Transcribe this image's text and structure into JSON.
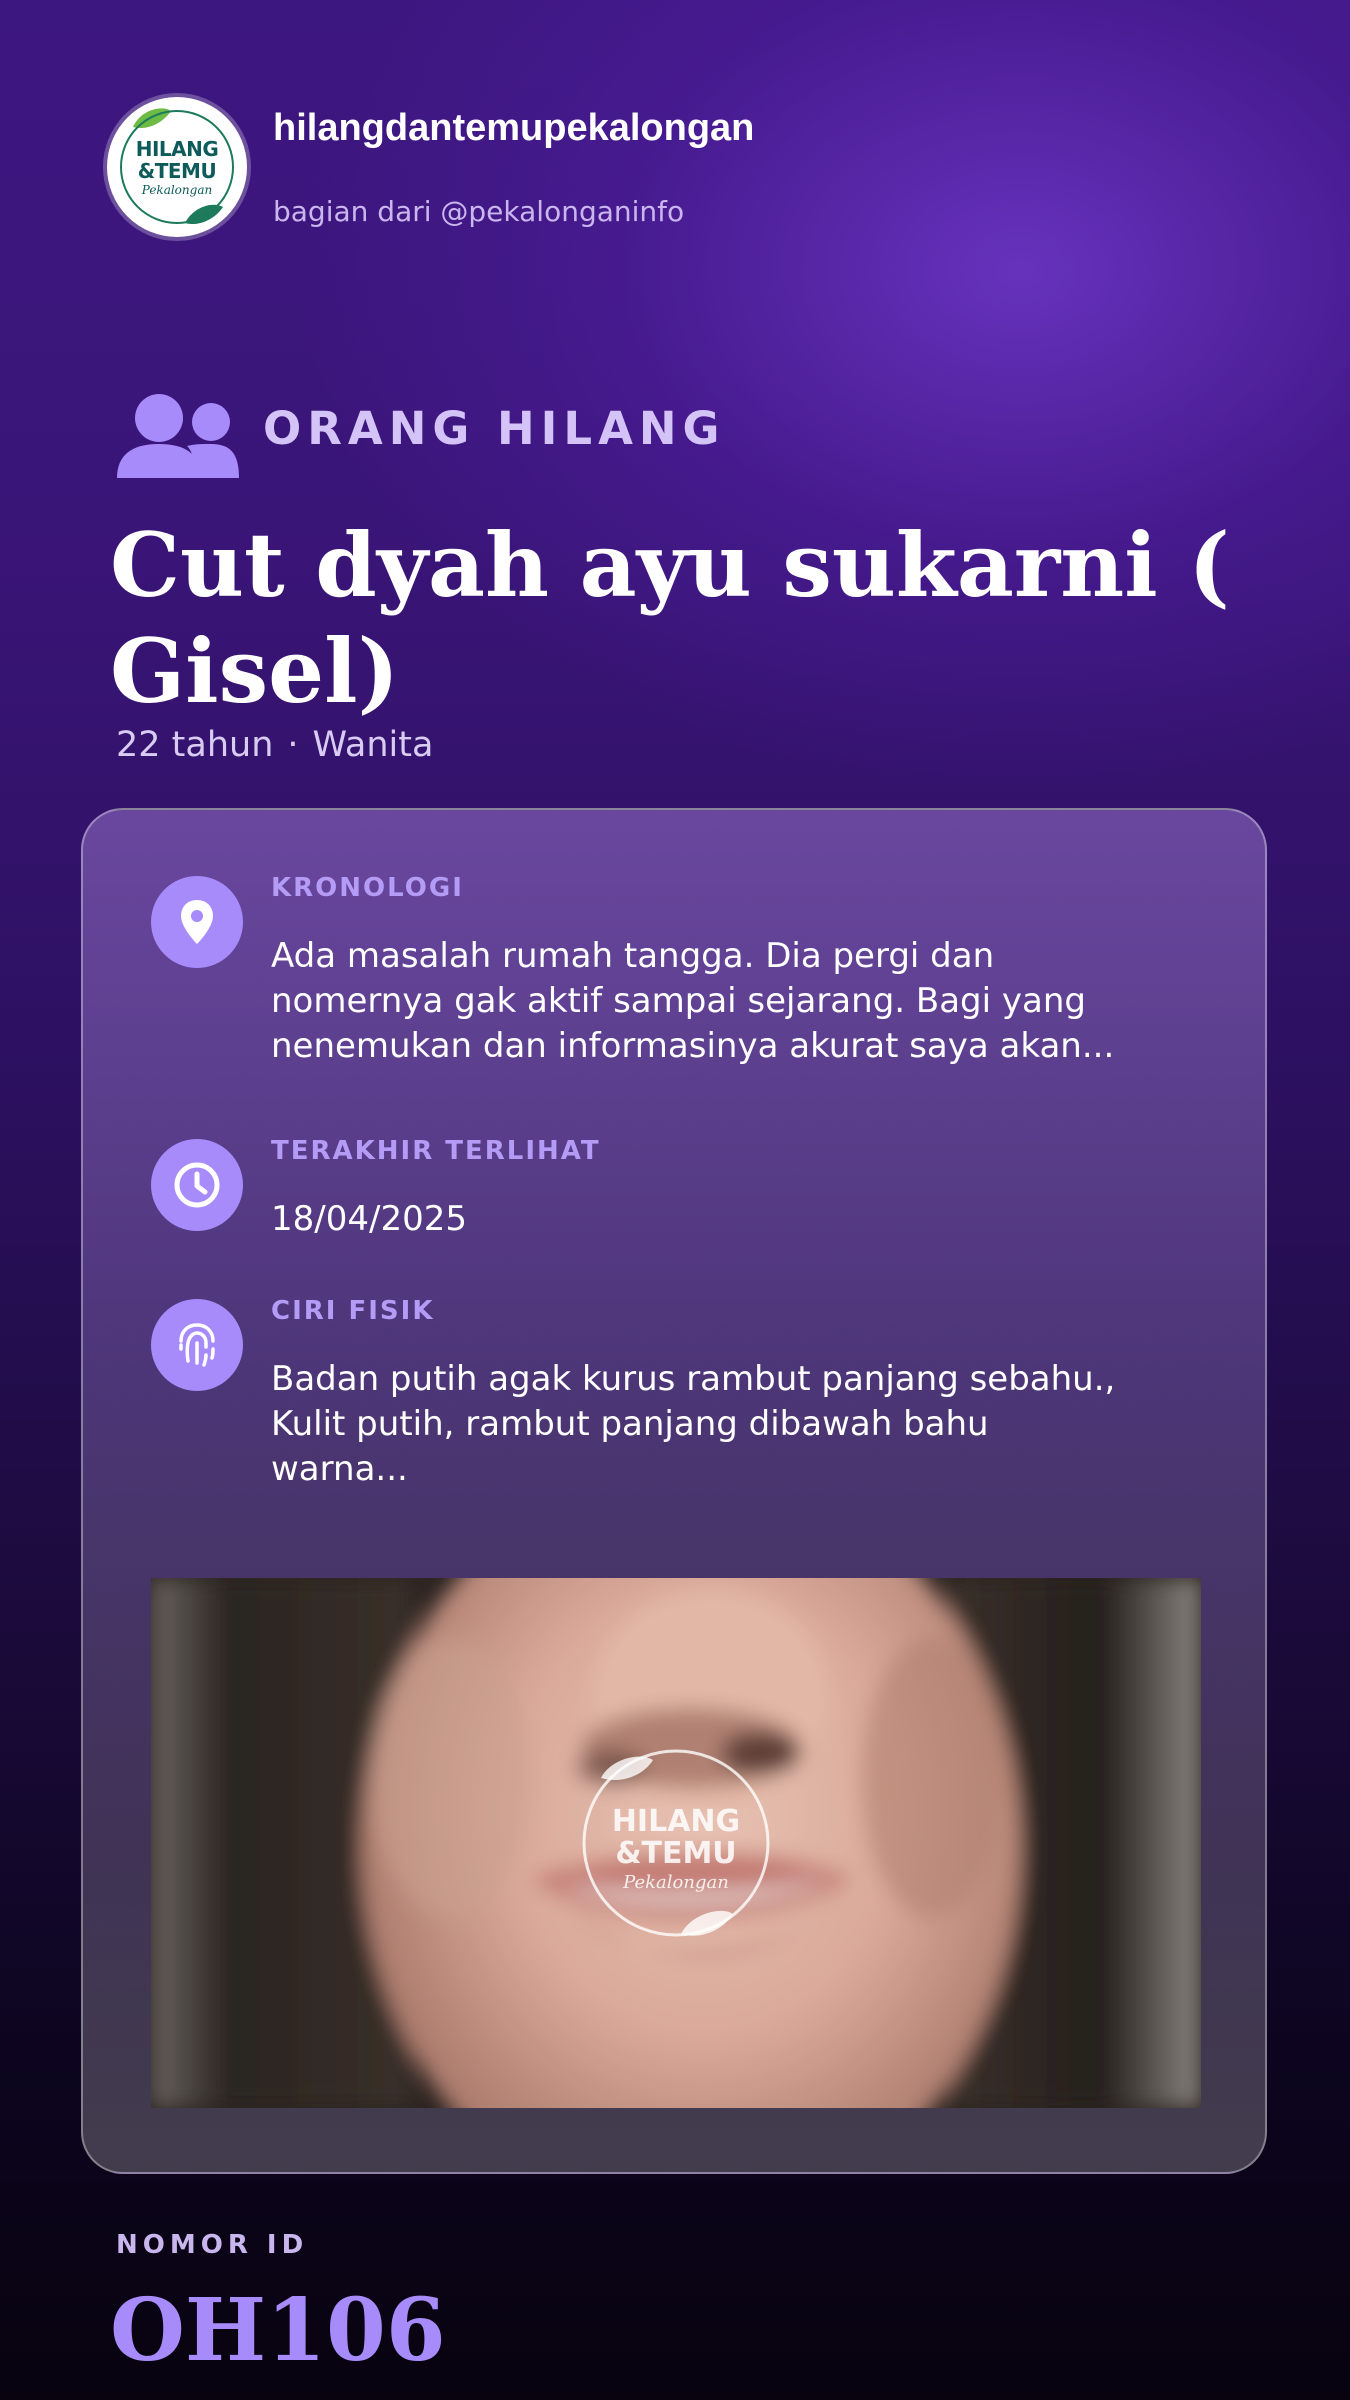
{
  "header": {
    "account_name": "hilangdantemupekalongan",
    "account_sub": "bagian dari @pekalonganinfo",
    "logo": {
      "line1": "HILANG",
      "line2": "&TEMU",
      "line3": "Pekalongan"
    }
  },
  "category": {
    "icon": "users-icon",
    "label": "ORANG HILANG"
  },
  "person": {
    "name": "Cut dyah ayu sukarni ( Gisel)",
    "age": "22 tahun",
    "separator": "·",
    "gender": "Wanita"
  },
  "details": [
    {
      "icon": "location-pin-icon",
      "title": "KRONOLOGI",
      "text": "Ada masalah rumah tangga. Dia pergi dan nomernya gak aktif sampai sejarang. Bagi yang nenemukan dan informasinya akurat saya akan..."
    },
    {
      "icon": "clock-icon",
      "title": "TERAKHIR TERLIHAT",
      "text": "18/04/2025"
    },
    {
      "icon": "fingerprint-icon",
      "title": "CIRI FISIK",
      "text": "Badan putih agak kurus rambut panjang sebahu., Kulit putih, rambut panjang dibawah bahu warna..."
    }
  ],
  "photo": {
    "watermark": {
      "line1": "HILANG",
      "line2": "&TEMU",
      "line3": "Pekalongan"
    }
  },
  "footer": {
    "id_label": "NOMOR ID",
    "id_value": "OH106"
  },
  "colors": {
    "accent": "#a78bfa",
    "title_accent": "#b49cf6",
    "background_top": "#3d1780",
    "background_bottom": "#08030f"
  }
}
